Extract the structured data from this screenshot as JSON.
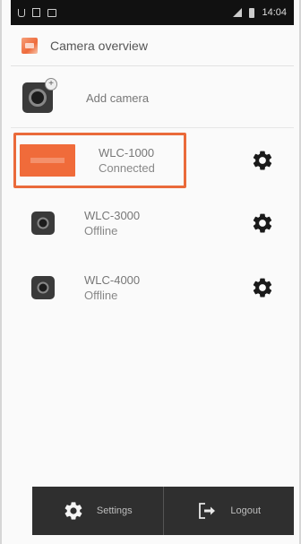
{
  "status_bar": {
    "time": "14:04"
  },
  "header": {
    "title": "Camera overview"
  },
  "add_row": {
    "label": "Add camera"
  },
  "cameras": [
    {
      "name": "WLC-1000",
      "status": "Connected"
    },
    {
      "name": "WLC-3000",
      "status": "Offline"
    },
    {
      "name": "WLC-4000",
      "status": "Offline"
    }
  ],
  "bottom_bar": {
    "settings_label": "Settings",
    "logout_label": "Logout"
  },
  "colors": {
    "accent": "#ea6a3a",
    "bar": "#2f2f2f",
    "status_bar": "#111111"
  },
  "icons": {
    "header": "app-logo-icon",
    "add": "add-camera-icon",
    "settings": "gear-icon",
    "logout": "logout-icon"
  }
}
